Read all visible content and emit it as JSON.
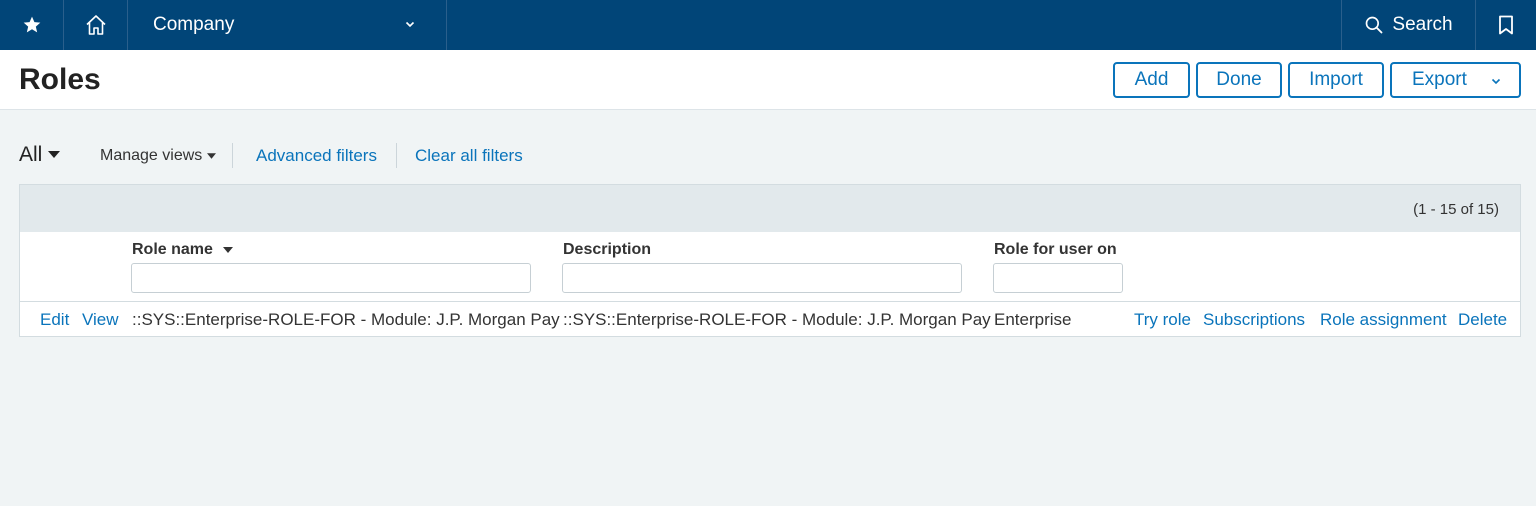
{
  "nav": {
    "favorites_icon": "star-icon",
    "home_icon": "home-icon",
    "company": "Company",
    "search": "Search",
    "bookmark_icon": "bookmark-icon"
  },
  "header": {
    "title": "Roles",
    "buttons": {
      "add": "Add",
      "done": "Done",
      "import": "Import",
      "export": "Export"
    }
  },
  "filters": {
    "view": "All",
    "manage_views": "Manage views",
    "advanced_filters": "Advanced filters",
    "clear_all_filters": "Clear all filters"
  },
  "table": {
    "count": "(1 - 15 of 15)",
    "columns": {
      "role_name": "Role name",
      "description": "Description",
      "role_for": "Role for user on"
    },
    "rows": [
      {
        "edit": "Edit",
        "view": "View",
        "role_name": "::SYS::Enterprise-ROLE-FOR - Module: J.P. Morgan Pay",
        "description": "::SYS::Enterprise-ROLE-FOR - Module: J.P. Morgan Pay",
        "role_for": "Enterprise",
        "try_role": "Try role",
        "subscriptions": "Subscriptions",
        "role_assignment": "Role assignment",
        "delete": "Delete"
      }
    ]
  },
  "colors": {
    "nav_bg": "#014578",
    "accent": "#0a74bb",
    "page_bg": "#f0f4f5"
  }
}
